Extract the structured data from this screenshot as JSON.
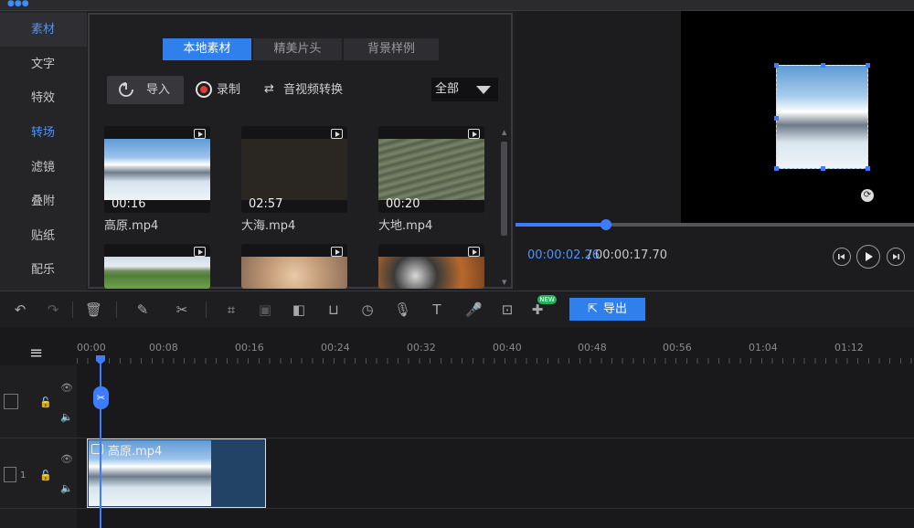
{
  "sidebar": {
    "items": [
      {
        "label": "素材",
        "active": true
      },
      {
        "label": "文字"
      },
      {
        "label": "特效"
      },
      {
        "label": "转场",
        "highlight": true
      },
      {
        "label": "滤镜"
      },
      {
        "label": "叠附"
      },
      {
        "label": "贴纸"
      },
      {
        "label": "配乐"
      }
    ]
  },
  "media": {
    "tabs": [
      "本地素材",
      "精美片头",
      "背景样例"
    ],
    "import_label": "导入",
    "record_label": "录制",
    "convert_label": "音视频转换",
    "filter_value": "全部",
    "files": [
      {
        "name": "高原.mp4",
        "duration": "00:16"
      },
      {
        "name": "大海.mp4",
        "duration": "02:57"
      },
      {
        "name": "大地.mp4",
        "duration": "00:20"
      }
    ]
  },
  "preview": {
    "current_time": "00:00:02.26",
    "separator": "/",
    "total_time": "00:00:17.70",
    "progress": 0.227
  },
  "toolbar": {
    "export_label": "导出",
    "new_badge": "NEW"
  },
  "timeline": {
    "ruler": [
      "00:00",
      "00:08",
      "00:16",
      "00:24",
      "00:32",
      "00:40",
      "00:48",
      "00:56",
      "01:04",
      "01:12"
    ],
    "track_number": "1",
    "clip_name": "高原.mp4"
  },
  "colors": {
    "accent": "#2f80ed",
    "background": "#1e1e21"
  }
}
